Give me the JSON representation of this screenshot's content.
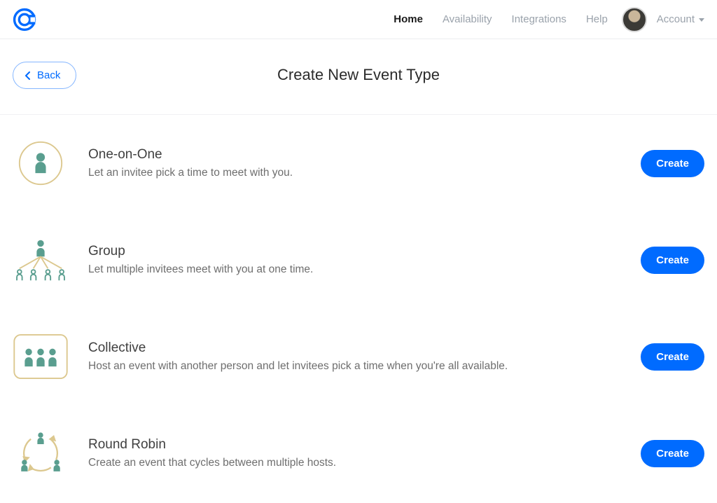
{
  "nav": {
    "home": "Home",
    "availability": "Availability",
    "integrations": "Integrations",
    "help": "Help",
    "account": "Account"
  },
  "header": {
    "back": "Back",
    "title": "Create New Event Type"
  },
  "events": {
    "oneOnOne": {
      "title": "One-on-One",
      "desc": "Let an invitee pick a time to meet with you.",
      "button": "Create"
    },
    "group": {
      "title": "Group",
      "desc": "Let multiple invitees meet with you at one time.",
      "button": "Create"
    },
    "collective": {
      "title": "Collective",
      "desc": "Host an event with another person and let invitees pick a time when you're all available.",
      "button": "Create"
    },
    "roundRobin": {
      "title": "Round Robin",
      "desc": "Create an event that cycles between multiple hosts.",
      "button": "Create"
    }
  },
  "colors": {
    "brandBlue": "#006bff",
    "iconTeal": "#5a9e8f",
    "iconGold": "#d9c48a"
  }
}
